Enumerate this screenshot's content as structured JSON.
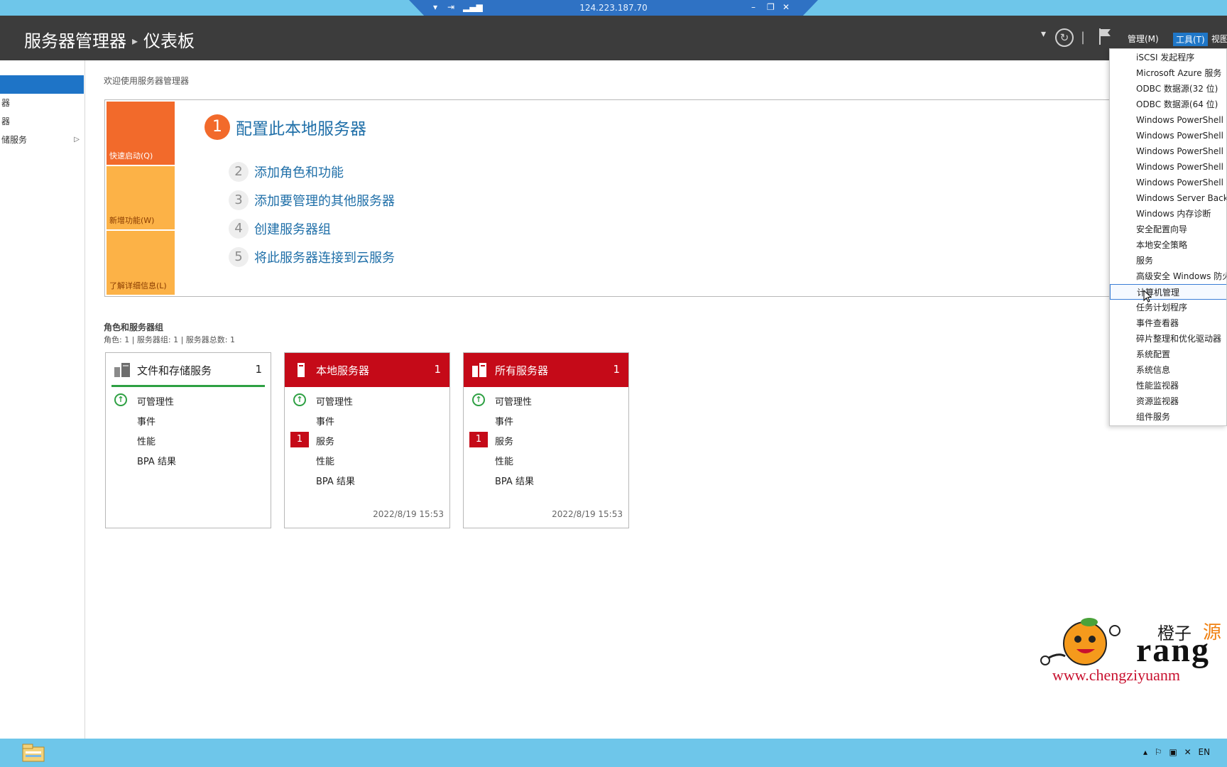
{
  "rdp": {
    "address": "124.223.187.70"
  },
  "header": {
    "app_title": "服务器管理器",
    "page_title": "仪表板",
    "menus": [
      {
        "label": "管理(M)"
      },
      {
        "label": "工具(T)"
      },
      {
        "label": "视图"
      }
    ]
  },
  "sidebar": {
    "items": [
      {
        "label": ""
      },
      {
        "label": "器"
      },
      {
        "label": "器"
      },
      {
        "label": "储服务"
      }
    ]
  },
  "main": {
    "welcome": "欢迎使用服务器管理器",
    "quick_start": {
      "tiles": [
        {
          "label": "快速启动(Q)"
        },
        {
          "label": "新增功能(W)"
        },
        {
          "label": "了解详细信息(L)"
        }
      ],
      "steps": [
        {
          "num": "1",
          "label": "配置此本地服务器"
        },
        {
          "num": "2",
          "label": "添加角色和功能"
        },
        {
          "num": "3",
          "label": "添加要管理的其他服务器"
        },
        {
          "num": "4",
          "label": "创建服务器组"
        },
        {
          "num": "5",
          "label": "将此服务器连接到云服务"
        }
      ]
    },
    "roles": {
      "title": "角色和服务器组",
      "summary": "角色: 1 | 服务器组: 1 | 服务器总数: 1",
      "cards": [
        {
          "name": "文件和存储服务",
          "count": "1",
          "rows": [
            {
              "label": "可管理性",
              "indicator": "ok"
            },
            {
              "label": "事件",
              "indicator": ""
            },
            {
              "label": "性能",
              "indicator": ""
            },
            {
              "label": "BPA 结果",
              "indicator": ""
            }
          ],
          "timestamp": ""
        },
        {
          "name": "本地服务器",
          "count": "1",
          "rows": [
            {
              "label": "可管理性",
              "indicator": "ok"
            },
            {
              "label": "事件",
              "indicator": ""
            },
            {
              "label": "服务",
              "indicator": "1"
            },
            {
              "label": "性能",
              "indicator": ""
            },
            {
              "label": "BPA 结果",
              "indicator": ""
            }
          ],
          "timestamp": "2022/8/19 15:53"
        },
        {
          "name": "所有服务器",
          "count": "1",
          "rows": [
            {
              "label": "可管理性",
              "indicator": "ok"
            },
            {
              "label": "事件",
              "indicator": ""
            },
            {
              "label": "服务",
              "indicator": "1"
            },
            {
              "label": "性能",
              "indicator": ""
            },
            {
              "label": "BPA 结果",
              "indicator": ""
            }
          ],
          "timestamp": "2022/8/19 15:53"
        }
      ]
    }
  },
  "tools_menu": {
    "items": [
      "iSCSI 发起程序",
      "Microsoft Azure 服务",
      "ODBC 数据源(32 位)",
      "ODBC 数据源(64 位)",
      "Windows PowerShell",
      "Windows PowerShell",
      "Windows PowerShell (",
      "Windows PowerShell I",
      "Windows PowerShell I",
      "Windows Server Backu",
      "Windows 内存诊断",
      "安全配置向导",
      "本地安全策略",
      "服务",
      "高级安全 Windows 防火",
      "计算机管理",
      "任务计划程序",
      "事件查看器",
      "碎片整理和优化驱动器",
      "系统配置",
      "系统信息",
      "性能监视器",
      "资源监视器",
      "组件服务"
    ],
    "highlighted": "计算机管理"
  },
  "watermark": {
    "cn_text": "橙子",
    "cn_text2": "源",
    "brand": "rang",
    "url": "www.chengziyuanm"
  },
  "taskbar": {
    "language": "EN"
  },
  "colors": {
    "accent": "#1e74c7",
    "alert_red": "#c50a18",
    "quick_start_orange": "#f26a2b",
    "quick_start_amber": "#fcb247",
    "ok_green": "#2ea043"
  }
}
